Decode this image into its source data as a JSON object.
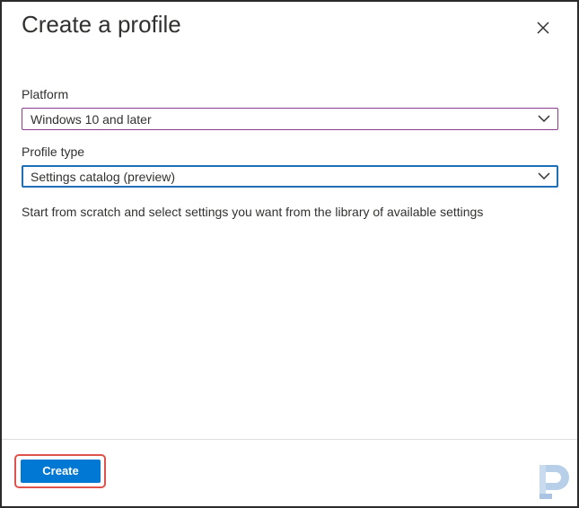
{
  "dialog": {
    "title": "Create a profile",
    "close_icon": "close-icon"
  },
  "platform": {
    "label": "Platform",
    "selected": "Windows 10 and later"
  },
  "profile_type": {
    "label": "Profile type",
    "selected": "Settings catalog (preview)"
  },
  "description": "Start from scratch and select settings you want from the library of available settings",
  "footer": {
    "create_label": "Create",
    "accent_color": "#0078d4",
    "highlight_color": "#e0534d"
  },
  "watermark_icon": "logo-watermark-icon"
}
